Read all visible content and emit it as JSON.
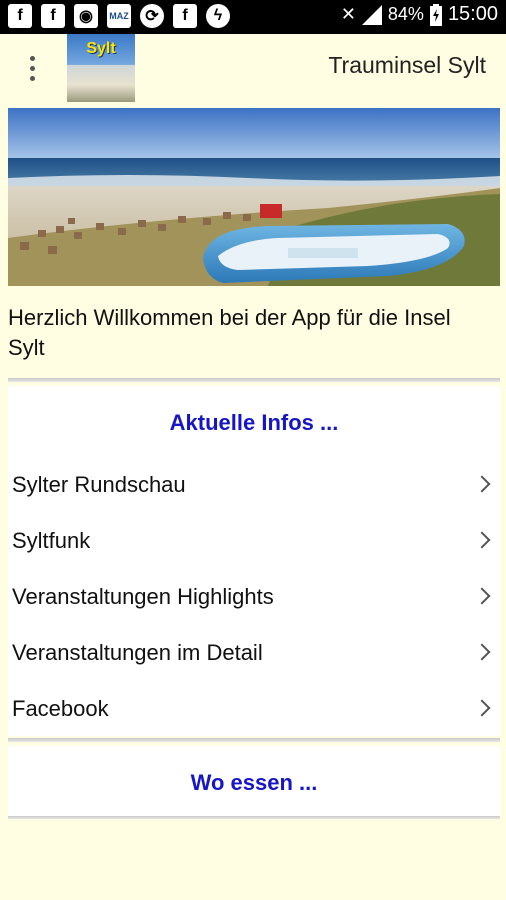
{
  "status_bar": {
    "icons": [
      "facebook-icon",
      "facebook-icon",
      "news-icon",
      "maz-icon",
      "sync-icon",
      "facebook-icon",
      "messenger-icon"
    ],
    "maz_text": "MAZ",
    "battery": "84%",
    "time": "15:00"
  },
  "app_bar": {
    "logo_text": "Sylt",
    "title": "Trauminsel Sylt"
  },
  "welcome": "Herzlich Willkommen bei der App für die Insel Sylt",
  "sections": [
    {
      "title": "Aktuelle Infos ...",
      "items": [
        {
          "label": "Sylter Rundschau"
        },
        {
          "label": "Syltfunk"
        },
        {
          "label": "Veranstaltungen Highlights"
        },
        {
          "label": "Veranstaltungen im Detail"
        },
        {
          "label": "Facebook"
        }
      ]
    },
    {
      "title": "Wo essen ...",
      "items": []
    }
  ],
  "colors": {
    "background": "#fffde2",
    "section_title": "#1616c8",
    "status_bar": "#000000"
  }
}
